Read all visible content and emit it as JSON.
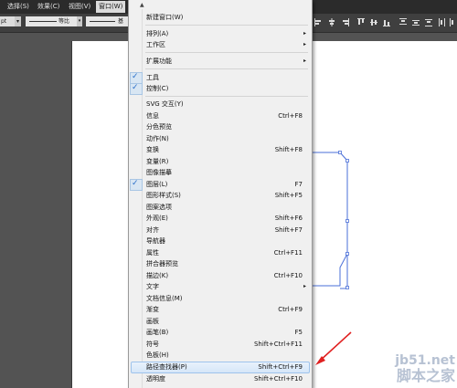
{
  "menubar": {
    "items": [
      {
        "label": "选择(S)"
      },
      {
        "label": "效果(C)"
      },
      {
        "label": "视图(V)"
      },
      {
        "label": "窗口(W)"
      }
    ]
  },
  "control_bar": {
    "stroke_unit": "pt",
    "stroke_profile_label": "等比",
    "brush_label": "基"
  },
  "window_menu": {
    "items": [
      {
        "label": "新建窗口(W)",
        "shortcut": "",
        "submenu": false,
        "checked": false
      },
      {
        "label": "排列(A)",
        "shortcut": "",
        "submenu": true,
        "checked": false
      },
      {
        "label": "工作区",
        "shortcut": "",
        "submenu": true,
        "checked": false
      },
      {
        "label": "扩展功能",
        "shortcut": "",
        "submenu": true,
        "checked": false
      },
      {
        "label": "工具",
        "shortcut": "",
        "submenu": false,
        "checked": true
      },
      {
        "label": "控制(C)",
        "shortcut": "",
        "submenu": false,
        "checked": true
      },
      {
        "label": "SVG 交互(Y)",
        "shortcut": "",
        "submenu": false,
        "checked": false
      },
      {
        "label": "信息",
        "shortcut": "Ctrl+F8",
        "submenu": false,
        "checked": false
      },
      {
        "label": "分色预览",
        "shortcut": "",
        "submenu": false,
        "checked": false
      },
      {
        "label": "动作(N)",
        "shortcut": "",
        "submenu": false,
        "checked": false
      },
      {
        "label": "变换",
        "shortcut": "Shift+F8",
        "submenu": false,
        "checked": false
      },
      {
        "label": "变量(R)",
        "shortcut": "",
        "submenu": false,
        "checked": false
      },
      {
        "label": "图像描摹",
        "shortcut": "",
        "submenu": false,
        "checked": false
      },
      {
        "label": "图层(L)",
        "shortcut": "F7",
        "submenu": false,
        "checked": true
      },
      {
        "label": "图形样式(S)",
        "shortcut": "Shift+F5",
        "submenu": false,
        "checked": false
      },
      {
        "label": "图案选项",
        "shortcut": "",
        "submenu": false,
        "checked": false
      },
      {
        "label": "外观(E)",
        "shortcut": "Shift+F6",
        "submenu": false,
        "checked": false
      },
      {
        "label": "对齐",
        "shortcut": "Shift+F7",
        "submenu": false,
        "checked": false
      },
      {
        "label": "导航器",
        "shortcut": "",
        "submenu": false,
        "checked": false
      },
      {
        "label": "属性",
        "shortcut": "Ctrl+F11",
        "submenu": false,
        "checked": false
      },
      {
        "label": "拼合器预览",
        "shortcut": "",
        "submenu": false,
        "checked": false
      },
      {
        "label": "描边(K)",
        "shortcut": "Ctrl+F10",
        "submenu": false,
        "checked": false
      },
      {
        "label": "文字",
        "shortcut": "",
        "submenu": true,
        "checked": false
      },
      {
        "label": "文档信息(M)",
        "shortcut": "",
        "submenu": false,
        "checked": false
      },
      {
        "label": "渐变",
        "shortcut": "Ctrl+F9",
        "submenu": false,
        "checked": false
      },
      {
        "label": "画板",
        "shortcut": "",
        "submenu": false,
        "checked": false
      },
      {
        "label": "画笔(B)",
        "shortcut": "F5",
        "submenu": false,
        "checked": false
      },
      {
        "label": "符号",
        "shortcut": "Shift+Ctrl+F11",
        "submenu": false,
        "checked": false
      },
      {
        "label": "色板(H)",
        "shortcut": "",
        "submenu": false,
        "checked": false
      },
      {
        "label": "路径查找器(P)",
        "shortcut": "Shift+Ctrl+F9",
        "submenu": false,
        "checked": false,
        "highlighted": true
      },
      {
        "label": "透明度",
        "shortcut": "Shift+Ctrl+F10",
        "submenu": false,
        "checked": false
      }
    ]
  },
  "watermark": {
    "url": "jb51.net",
    "name": "脚本之家"
  },
  "colors": {
    "menubar_bg": "#2b2b2b",
    "menu_bg": "#f0f0f0",
    "highlight": "#d5e6f8",
    "check": "#2a6fc9",
    "path_stroke": "#4a6fd8",
    "arrow": "#e02020"
  },
  "icons": {
    "checkmark": "check-icon",
    "submenu_arrow": "chevron-right-icon",
    "scroll_up": "scroll-up-icon",
    "annotation": "red-arrow-icon"
  }
}
